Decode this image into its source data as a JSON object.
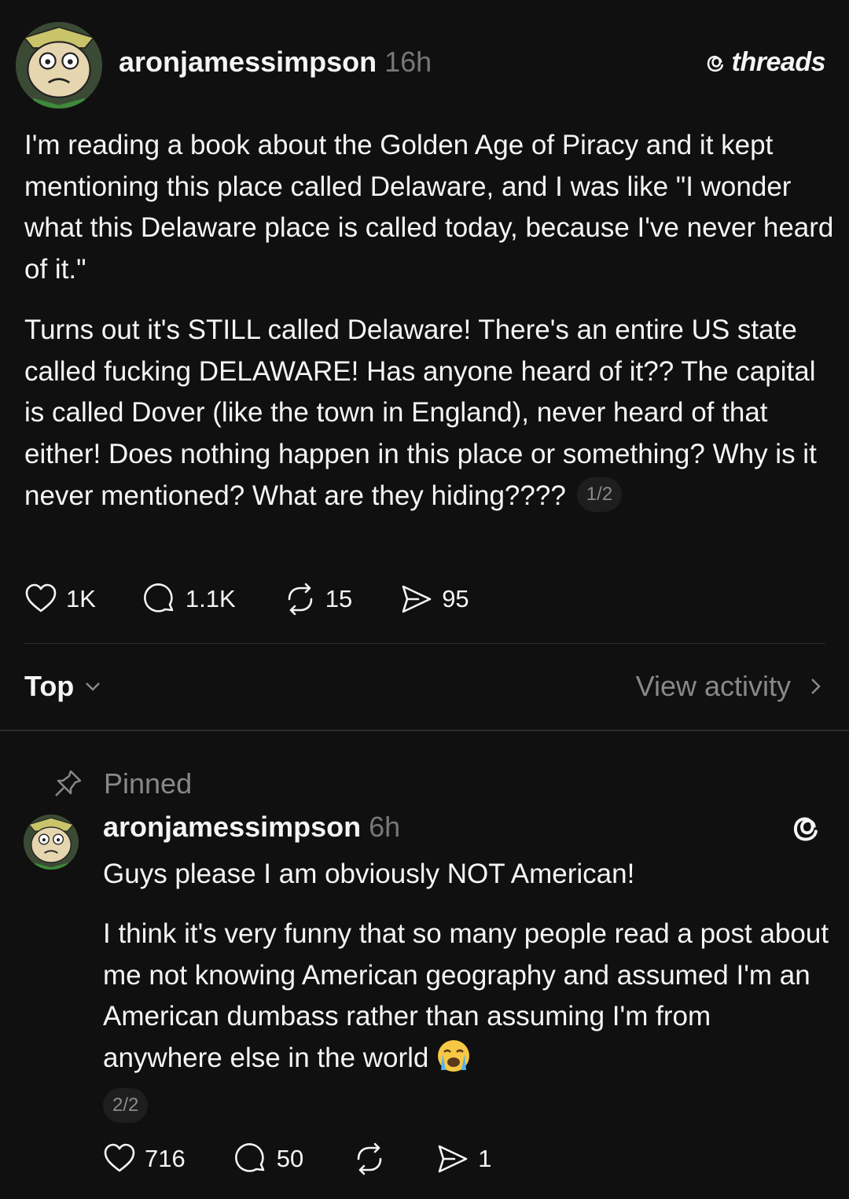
{
  "post": {
    "username": "aronjamessimpson",
    "time": "16h",
    "brand": "threads",
    "paragraph1": "I'm reading a book about the Golden Age of Piracy and it kept mentioning this place called Delaware, and I was like \"I wonder what this Delaware place is called today, because I've never heard of it.\"",
    "paragraph2": "Turns out it's STILL called Delaware! There's an entire US state called fucking DELAWARE! Has anyone heard of it?? The capital is called Dover (like the town in England), never heard of that either! Does nothing happen in this place or something? Why is it never mentioned? What are they hiding????",
    "pager": "1/2",
    "likes": "1K",
    "replies": "1.1K",
    "reposts": "15",
    "shares": "95"
  },
  "sort": {
    "label": "Top",
    "view_activity": "View activity"
  },
  "reply": {
    "pinned_label": "Pinned",
    "username": "aronjamessimpson",
    "time": "6h",
    "paragraph1": "Guys please I am obviously NOT American!",
    "paragraph2": "I think it's very funny that so many people read a post about me not knowing American geography and assumed I'm an American dumbass rather than assuming I'm from anywhere else in the world",
    "emoji": "loudly-crying-face",
    "pager": "2/2",
    "likes": "716",
    "replies": "50",
    "shares": "1"
  },
  "colors": {
    "background": "#101010",
    "text": "#f3f5f7",
    "muted": "#777777"
  }
}
